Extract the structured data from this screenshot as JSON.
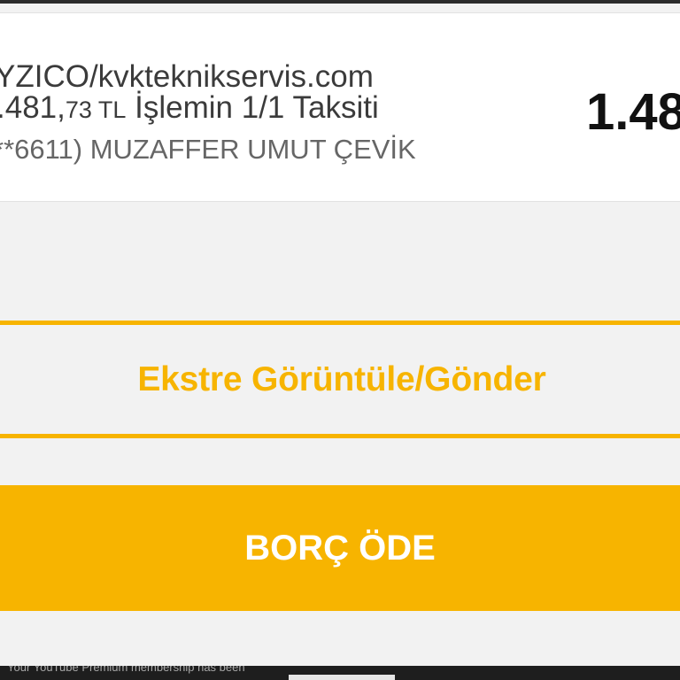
{
  "transaction": {
    "merchant": "YZICO/kvkteknikservis.com",
    "installment_amount_main": ".481,",
    "installment_amount_small": "73 TL",
    "installment_text": " İşlemin 1/1 Taksiti",
    "cardholder": "**6611) MUZAFFER UMUT ÇEVİK",
    "amount": "1.48"
  },
  "actions": {
    "statement_label": "Ekstre Görüntüle/Gönder",
    "pay_label": "BORÇ ÖDE"
  },
  "notification": {
    "text": "Your YouTube Premium membership has been"
  },
  "colors": {
    "accent": "#f7b400",
    "background": "#f2f2f2",
    "card": "#ffffff"
  }
}
